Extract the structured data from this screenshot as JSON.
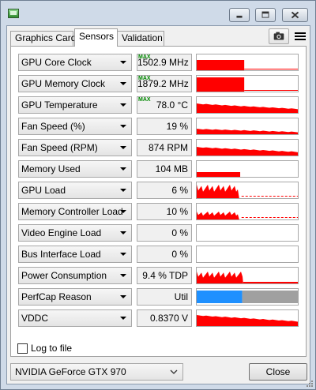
{
  "tabs": [
    {
      "label": "Graphics Card",
      "active": false
    },
    {
      "label": "Sensors",
      "active": true
    },
    {
      "label": "Validation",
      "active": false
    }
  ],
  "toolbar": {
    "camera_icon": "camera-icon",
    "menu_icon": "hamburger-menu-icon"
  },
  "colors": {
    "graph_fill": "#ff0000",
    "perfcap_blue": "#1e90ff",
    "perfcap_gray": "#a0a0a0",
    "max_flag": "#008800"
  },
  "sensors": [
    {
      "name": "GPU Core Clock",
      "value": "1502.9 MHz",
      "max_flag": "MAX",
      "graph": {
        "type": "step",
        "level": 0.65,
        "end": 0.47,
        "baseline": 0.05
      }
    },
    {
      "name": "GPU Memory Clock",
      "value": "1879.2 MHz",
      "max_flag": "MAX",
      "graph": {
        "type": "step",
        "level": 0.9,
        "end": 0.47,
        "baseline": 0.05
      }
    },
    {
      "name": "GPU Temperature",
      "value": "78.0 °C",
      "max_flag": "MAX",
      "graph": {
        "type": "plateau",
        "level": 0.6
      }
    },
    {
      "name": "Fan Speed (%)",
      "value": "19 %",
      "max_flag": "",
      "graph": {
        "type": "plateau",
        "level": 0.35
      }
    },
    {
      "name": "Fan Speed (RPM)",
      "value": "874 RPM",
      "max_flag": "",
      "graph": {
        "type": "plateau",
        "level": 0.55
      }
    },
    {
      "name": "Memory Used",
      "value": "104 MB",
      "max_flag": "",
      "graph": {
        "type": "step",
        "level": 0.3,
        "end": 0.43,
        "baseline": 0
      }
    },
    {
      "name": "GPU Load",
      "value": "6 %",
      "max_flag": "",
      "graph": {
        "type": "noisy",
        "level": 0.85,
        "end": 0.42,
        "dashed": true
      }
    },
    {
      "name": "Memory Controller Load",
      "value": "10 %",
      "max_flag": "",
      "graph": {
        "type": "noisy",
        "level": 0.5,
        "end": 0.42,
        "dashed": true
      }
    },
    {
      "name": "Video Engine Load",
      "value": "0 %",
      "max_flag": "",
      "graph": {
        "type": "empty"
      }
    },
    {
      "name": "Bus Interface Load",
      "value": "0 %",
      "max_flag": "",
      "graph": {
        "type": "empty"
      }
    },
    {
      "name": "Power Consumption",
      "value": "9.4 % TDP",
      "max_flag": "",
      "graph": {
        "type": "noisy",
        "level": 0.75,
        "end": 0.46,
        "dashed": false,
        "tail": 0.1
      }
    },
    {
      "name": "PerfCap Reason",
      "value": "Util",
      "max_flag": "",
      "graph": {
        "type": "perfcap",
        "split": 0.45
      }
    },
    {
      "name": "VDDC",
      "value": "0.8370 V",
      "max_flag": "",
      "graph": {
        "type": "plateau",
        "level": 0.7
      }
    }
  ],
  "log_to_file": {
    "label": "Log to file",
    "checked": false
  },
  "gpu_selector": {
    "value": "NVIDIA GeForce GTX 970"
  },
  "close_button": {
    "label": "Close"
  }
}
